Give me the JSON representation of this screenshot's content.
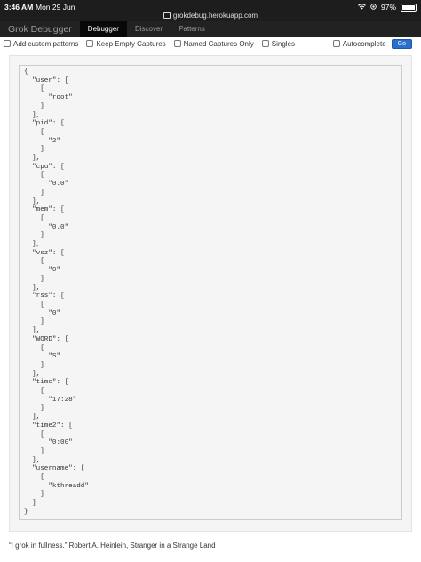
{
  "status": {
    "time": "3:46 AM",
    "date": "Mon 29 Jun",
    "battery": "97%",
    "battery_level": 0.97,
    "url": "grokdebug.herokuapp.com"
  },
  "nav": {
    "brand": "Grok Debugger",
    "items": [
      "Debugger",
      "Discover",
      "Patterns"
    ],
    "active": "Debugger"
  },
  "options": {
    "add_custom": "Add custom patterns",
    "keep_empty": "Keep Empty Captures",
    "named_only": "Named Captures Only",
    "singles": "Singles",
    "autocomplete": "Autocomplete",
    "go": "Go"
  },
  "result": {
    "user": [
      "root"
    ],
    "pid": [
      "2"
    ],
    "cpu": [
      "0.0"
    ],
    "mem": [
      "0.0"
    ],
    "vsz": [
      "0"
    ],
    "rss": [
      "0"
    ],
    "WORD": [
      "S"
    ],
    "time": [
      "17:28"
    ],
    "time2": [
      "0:00"
    ],
    "username": [
      "kthreadd"
    ]
  },
  "footer": {
    "quote": "“I grok in fullness.” Robert A. Heinlein, Stranger in a Strange Land"
  }
}
